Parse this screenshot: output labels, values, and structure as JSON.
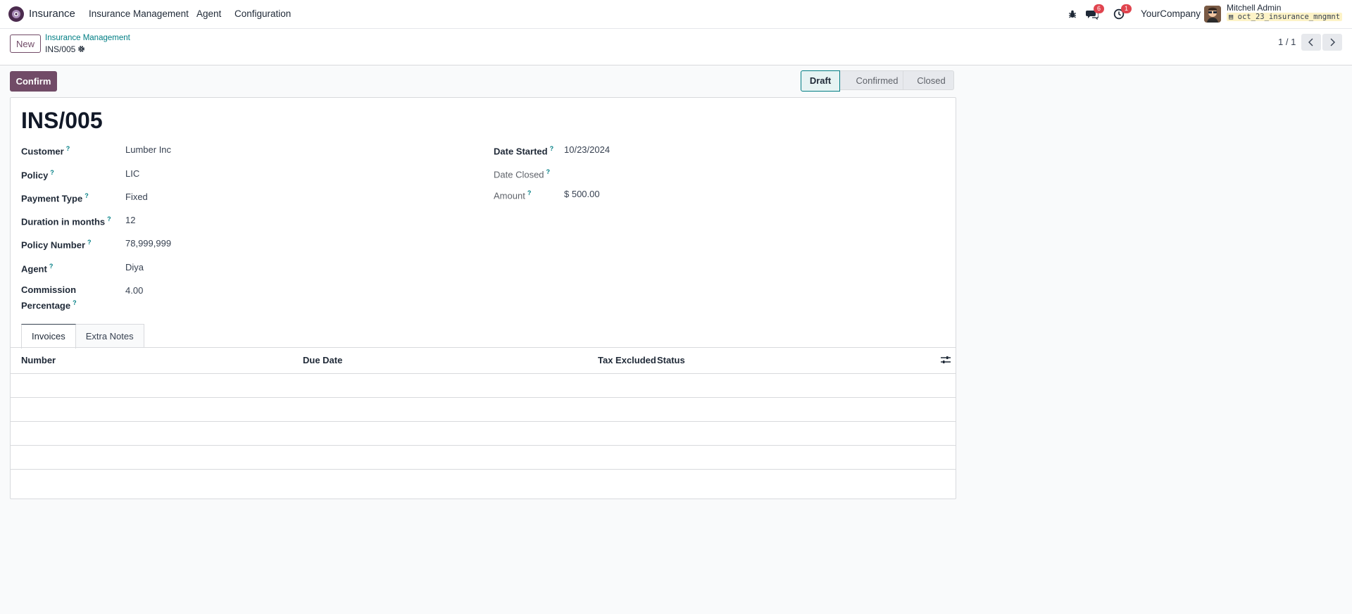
{
  "navbar": {
    "app_name": "Insurance",
    "menu": [
      "Insurance Management",
      "Agent",
      "Configuration"
    ],
    "messages_badge": "6",
    "activities_badge": "1",
    "company": "YourCompany",
    "user_name": "Mitchell Admin",
    "database": "oct_23_insurance_mngmnt"
  },
  "control_panel": {
    "new_label": "New",
    "breadcrumb_parent": "Insurance Management",
    "breadcrumb_current": "INS/005",
    "pager": "1 / 1"
  },
  "header": {
    "confirm_label": "Confirm",
    "status_steps": [
      "Draft",
      "Confirmed",
      "Closed"
    ],
    "current_status": "Draft"
  },
  "form": {
    "title": "INS/005",
    "help_mark": "?",
    "left_fields": [
      {
        "label": "Customer",
        "value": "Lumber Inc"
      },
      {
        "label": "Policy",
        "value": "LIC"
      },
      {
        "label": "Payment Type",
        "value": "Fixed"
      },
      {
        "label": "Duration in months",
        "value": "12"
      },
      {
        "label": "Policy Number",
        "value": "78,999,999"
      },
      {
        "label": "Agent",
        "value": "Diya"
      },
      {
        "label_line1": "Commission",
        "label_line2": "Percentage",
        "value": "4.00"
      }
    ],
    "right_fields": [
      {
        "label": "Date Started",
        "value": "10/23/2024"
      },
      {
        "label": "Date Closed",
        "value": ""
      },
      {
        "label": "Amount",
        "value": "$ 500.00"
      }
    ]
  },
  "notebook": {
    "tabs": [
      "Invoices",
      "Extra Notes"
    ],
    "active_tab": "Invoices",
    "columns": [
      "Number",
      "Due Date",
      "Tax Excluded",
      "Status"
    ],
    "rows": []
  },
  "colors": {
    "brand": "#714b67",
    "accent": "#017e84",
    "badge": "#e0444e"
  },
  "icons": [
    "app-logo-icon",
    "bug-icon",
    "chat-icon",
    "clock-icon",
    "gear-icon",
    "chevron-left-icon",
    "chevron-right-icon",
    "optional-columns-icon",
    "database-icon"
  ]
}
